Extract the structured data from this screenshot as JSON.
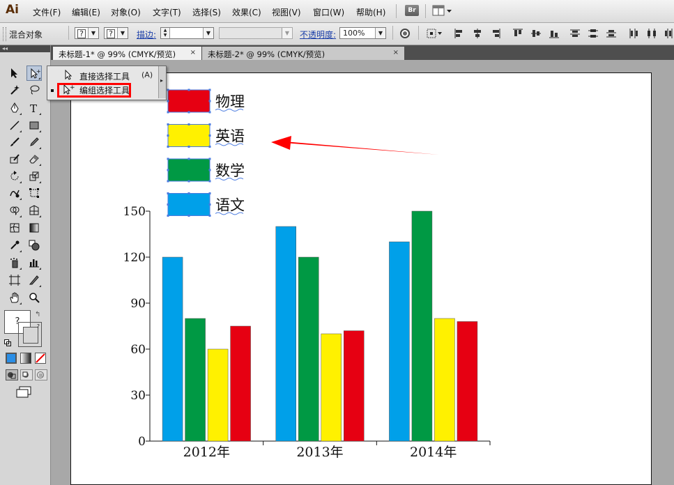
{
  "app": {
    "logo": "Ai"
  },
  "menu": [
    "文件(F)",
    "编辑(E)",
    "对象(O)",
    "文字(T)",
    "选择(S)",
    "效果(C)",
    "视图(V)",
    "窗口(W)",
    "帮助(H)"
  ],
  "menubar_buttons": {
    "bridge": "Br"
  },
  "control_bar": {
    "selection_label": "混合对象",
    "fill_value": "?",
    "stroke_value": "?",
    "stroke_label": "描边:",
    "opacity_label": "不透明度:",
    "opacity_value": "100%"
  },
  "tabs": [
    {
      "title": "未标题-1* @ 99% (CMYK/预览)",
      "active": true,
      "close": "×"
    },
    {
      "title": "未标题-2* @ 99% (CMYK/预览)",
      "active": false,
      "close": "×"
    }
  ],
  "toolbox": {
    "collapse_glyph": "◂◂",
    "fill_unknown": "?",
    "stroke_unknown": "?"
  },
  "flyout": {
    "items": [
      {
        "label": "直接选择工具",
        "shortcut": "(A)"
      },
      {
        "label": "编组选择工具"
      }
    ]
  },
  "colors": {
    "physics": "#e60012",
    "english": "#fff100",
    "math": "#009944",
    "chinese": "#00a0e9",
    "annotation": "#ff0000",
    "selection": "#4a7be0"
  },
  "chart_data": {
    "type": "bar",
    "categories": [
      "2012年",
      "2013年",
      "2014年"
    ],
    "series": [
      {
        "name": "语文",
        "values": [
          120,
          140,
          130
        ],
        "color": "#00a0e9"
      },
      {
        "name": "数学",
        "values": [
          80,
          120,
          150
        ],
        "color": "#009944"
      },
      {
        "name": "英语",
        "values": [
          60,
          70,
          80
        ],
        "color": "#fff100"
      },
      {
        "name": "物理",
        "values": [
          75,
          72,
          78
        ],
        "color": "#e60012"
      }
    ],
    "legend_order": [
      "物理",
      "英语",
      "数学",
      "语文"
    ],
    "yticks": [
      0,
      30,
      60,
      90,
      120,
      150
    ],
    "ylim": [
      0,
      150
    ],
    "legend_position": "top-left",
    "grid": false
  }
}
